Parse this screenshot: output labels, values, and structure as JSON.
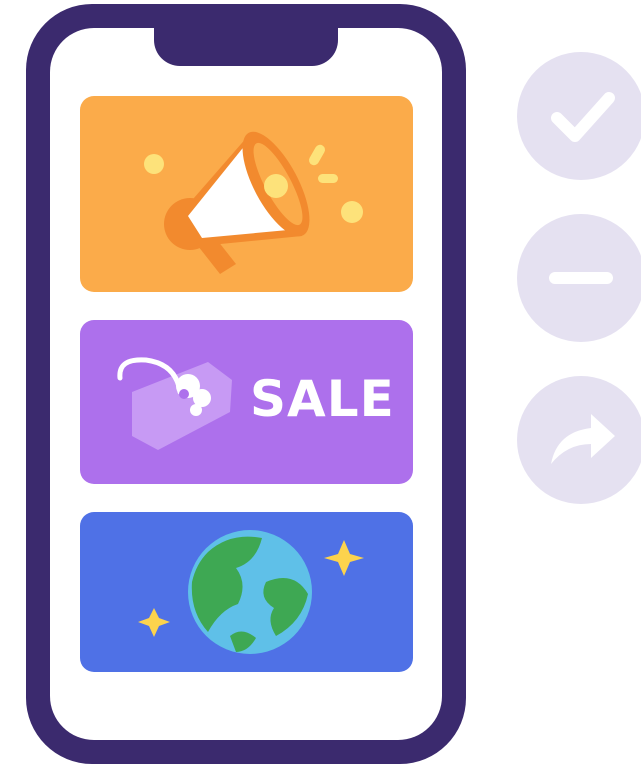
{
  "colors": {
    "frame": "#3b2a6e",
    "orange": "#fbab4a",
    "purple": "#ad70ec",
    "blue": "#4f71e6",
    "button": "#e5e1f1",
    "button_icon": "#ffffff"
  },
  "cards": [
    {
      "theme": "announcement",
      "icon": "megaphone-icon"
    },
    {
      "theme": "sale",
      "icon": "price-tag-icon",
      "label": "SALE"
    },
    {
      "theme": "world",
      "icon": "globe-icon"
    }
  ],
  "actions": [
    {
      "icon": "checkmark-icon"
    },
    {
      "icon": "minus-icon"
    },
    {
      "icon": "share-arrow-icon"
    }
  ]
}
